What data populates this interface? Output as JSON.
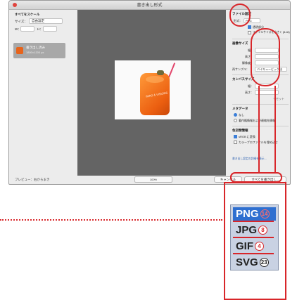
{
  "window": {
    "title": "書き出し形式"
  },
  "left": {
    "section_title": "すべてをスケール",
    "size_label": "サイズ：",
    "size_value": "自由設定",
    "w_prefix": "W：",
    "h_prefix": "H：",
    "asset_label": "書き出し済み",
    "asset_sub": "1800×1200 px"
  },
  "preview": {
    "caption": "IMAG & VISIONS"
  },
  "right": {
    "file_settings_title": "ファイル設定",
    "format_label": "形式：",
    "format_value": "PNG",
    "transparency_label": "透明部分",
    "small_file_label": "ファイルサイズを小さく (8-bit)",
    "image_size_title": "画像サイズ",
    "width_label": "幅：",
    "height_label": "高さ：",
    "resolution_label": "解像度：",
    "resample_label": "再サンプル：",
    "resample_value": "バイキュービック法",
    "canvas_title": "カンバスサイズ",
    "canvas_width_label": "幅：",
    "canvas_height_label": "高さ：",
    "reset_label": "リセット",
    "metadata_title": "メタデータ",
    "meta_none": "なし",
    "meta_copyright": "著作権情報および連絡先情報",
    "color_title": "色空間情報",
    "srgb_label": "sRGB に変換",
    "embed_profile_label": "カラープロファイルを埋め込む",
    "footer_link": "書き出し設定の詳細を表示..."
  },
  "bottom": {
    "preview_label": "プレビュー：右からまき",
    "zoom_value": "100%",
    "cancel_label": "キャンセル",
    "export_all_label": "すべてを書き出し..."
  },
  "format_dropdown": {
    "options": [
      {
        "label": "PNG",
        "badge": "14",
        "selected": true
      },
      {
        "label": "JPG",
        "badge": "8",
        "selected": false
      },
      {
        "label": "GIF",
        "badge": "4",
        "selected": false
      },
      {
        "label": "SVG",
        "badge": "23",
        "selected": false
      }
    ]
  },
  "colors": {
    "annotation": "#d8262a",
    "selection": "#2e6fd0"
  }
}
